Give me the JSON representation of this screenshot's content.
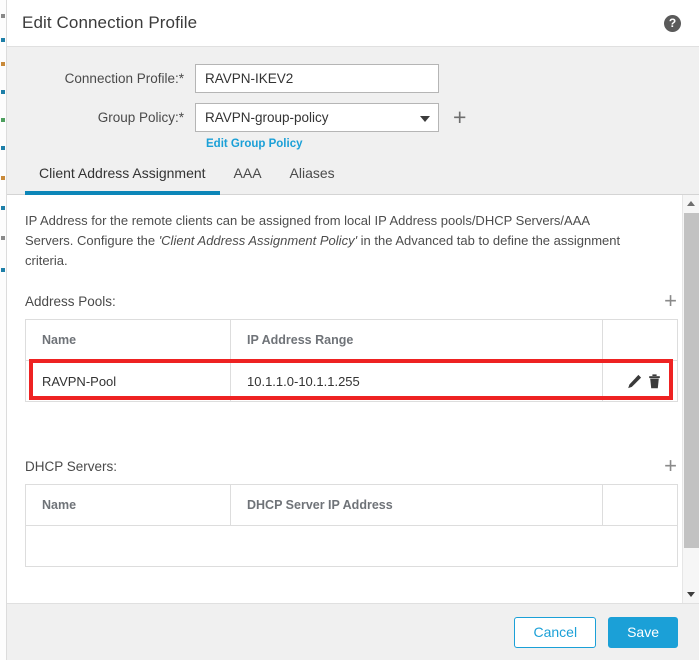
{
  "dialog": {
    "title": "Edit Connection Profile",
    "help_icon": "help-circle-icon"
  },
  "form": {
    "connection_profile": {
      "label": "Connection Profile:*",
      "value": "RAVPN-IKEV2"
    },
    "group_policy": {
      "label": "Group Policy:*",
      "value": "RAVPN-group-policy",
      "add_label": "+",
      "edit_link": "Edit Group Policy"
    }
  },
  "tabs": [
    {
      "label": "Client Address Assignment",
      "active": true
    },
    {
      "label": "AAA",
      "active": false
    },
    {
      "label": "Aliases",
      "active": false
    }
  ],
  "content": {
    "description_part1": "IP Address for the remote clients can be assigned from local IP Address pools/DHCP Servers/AAA Servers. Configure the ",
    "description_italic": "'Client Address Assignment Policy'",
    "description_part2": " in the Advanced tab to define the assignment criteria.",
    "address_pools": {
      "title": "Address Pools:",
      "add_label": "+",
      "columns": [
        "Name",
        "IP Address Range",
        ""
      ],
      "rows": [
        {
          "name": "RAVPN-Pool",
          "range": "10.1.1.0-10.1.1.255",
          "edit_icon": "pencil-icon",
          "delete_icon": "trash-icon"
        }
      ],
      "highlight_color": "#ee2222"
    },
    "dhcp_servers": {
      "title": "DHCP Servers:",
      "add_label": "+",
      "columns": [
        "Name",
        "DHCP Server IP Address",
        ""
      ],
      "rows": []
    }
  },
  "scrollbar": {
    "up_icon": "chevron-up-icon",
    "down_icon": "chevron-down-icon"
  },
  "footer": {
    "cancel_label": "Cancel",
    "save_label": "Save"
  },
  "colors": {
    "accent_blue": "#1ba0d7",
    "tab_active_blue": "#0c86b8",
    "highlight_red": "#ee2222"
  }
}
